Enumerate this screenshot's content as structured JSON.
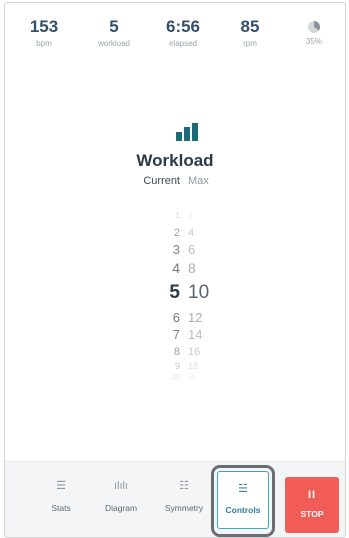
{
  "stats": [
    {
      "value": "153",
      "unit": "bpm"
    },
    {
      "value": "5",
      "unit": "workload"
    },
    {
      "value": "6:56",
      "unit": "elapsed"
    },
    {
      "value": "85",
      "unit": "rpm"
    },
    {
      "value": "",
      "unit": "35%",
      "progress_percent": 35
    }
  ],
  "workload": {
    "icon": "bar-chart-icon",
    "accent_color": "#1a6b75",
    "title": "Workload",
    "current_label": "Current",
    "max_label": "Max",
    "rows": [
      {
        "current": "1",
        "max": "2"
      },
      {
        "current": "2",
        "max": "4"
      },
      {
        "current": "3",
        "max": "6"
      },
      {
        "current": "4",
        "max": "8"
      },
      {
        "current": "5",
        "max": "10"
      },
      {
        "current": "6",
        "max": "12"
      },
      {
        "current": "7",
        "max": "14"
      },
      {
        "current": "8",
        "max": "16"
      },
      {
        "current": "9",
        "max": "18"
      },
      {
        "current": "10",
        "max": "20"
      }
    ],
    "selected_current": "5"
  },
  "nav": {
    "items": [
      {
        "label": "Stats",
        "icon": "list-icon"
      },
      {
        "label": "Diagram",
        "icon": "bars-icon"
      },
      {
        "label": "Symmetry",
        "icon": "symmetry-icon"
      },
      {
        "label": "Controls",
        "icon": "sliders-icon"
      }
    ],
    "stop": {
      "label": "STOP",
      "icon": "pause-icon",
      "color": "#f25c56"
    }
  }
}
